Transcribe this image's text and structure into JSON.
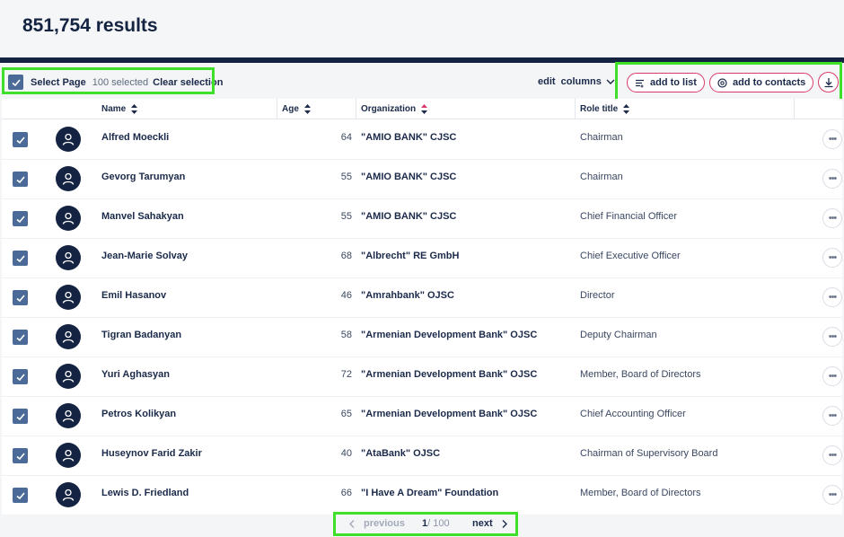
{
  "header": {
    "results_title": "851,754 results"
  },
  "toolbar": {
    "select_page_label": "Select Page",
    "selected_count": "100 selected",
    "clear_selection": "Clear selection",
    "edit_columns": "edit  columns",
    "add_to_list": "add to list",
    "add_to_contacts": "add to contacts"
  },
  "table": {
    "columns": [
      "Name",
      "Age",
      "Organization",
      "Role title"
    ],
    "rows": [
      {
        "name": "Alfred Moeckli",
        "age": "64",
        "org": "\"AMIO BANK\" CJSC",
        "role": "Chairman"
      },
      {
        "name": "Gevorg Tarumyan",
        "age": "55",
        "org": "\"AMIO BANK\" CJSC",
        "role": "Chairman"
      },
      {
        "name": "Manvel Sahakyan",
        "age": "55",
        "org": "\"AMIO BANK\" CJSC",
        "role": "Chief Financial Officer"
      },
      {
        "name": "Jean-Marie Solvay",
        "age": "68",
        "org": "\"Albrecht\" RE GmbH",
        "role": "Chief Executive Officer"
      },
      {
        "name": "Emil Hasanov",
        "age": "46",
        "org": "\"Amrahbank\" OJSC",
        "role": "Director"
      },
      {
        "name": "Tigran Badanyan",
        "age": "58",
        "org": "\"Armenian Development Bank\" OJSC",
        "role": "Deputy Chairman"
      },
      {
        "name": "Yuri Aghasyan",
        "age": "72",
        "org": "\"Armenian Development Bank\" OJSC",
        "role": "Member, Board of Directors"
      },
      {
        "name": "Petros Kolikyan",
        "age": "65",
        "org": "\"Armenian Development Bank\" OJSC",
        "role": "Chief Accounting Officer"
      },
      {
        "name": "Huseynov Farid Zakir",
        "age": "40",
        "org": "\"AtaBank\" OJSC",
        "role": "Chairman of Supervisory Board"
      },
      {
        "name": "Lewis D. Friedland",
        "age": "66",
        "org": "\"I Have A Dream\" Foundation",
        "role": "Member, Board of Directors"
      }
    ],
    "more_label": "•••"
  },
  "pager": {
    "previous": "previous",
    "current": "1",
    "total": "/ 100",
    "next": "next"
  },
  "colors": {
    "navy": "#142341",
    "checkbox": "#4b6a97",
    "accent_pink": "#d93a6a",
    "highlight_green": "#3fe02a"
  }
}
